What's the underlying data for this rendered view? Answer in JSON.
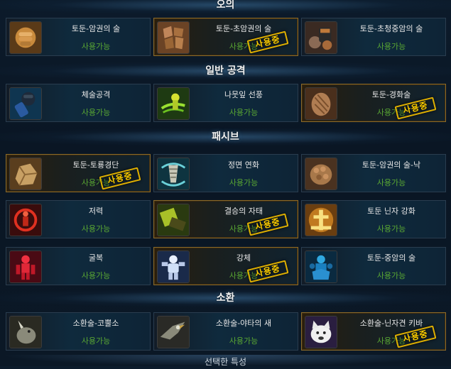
{
  "sections": [
    {
      "title": "오의"
    },
    {
      "title": "일반 공격"
    },
    {
      "title": "패시브"
    },
    {
      "title": "소환"
    }
  ],
  "skills": [
    {
      "name": "토둔-암권의 술",
      "status": "사용가능",
      "icon": "fist-icon",
      "active": false
    },
    {
      "name": "토둔-초암권의 술",
      "status": "사용가능",
      "icon": "rock-body-icon",
      "active": true
    },
    {
      "name": "토둔-초청중암의 술",
      "status": "사용가능",
      "icon": "heavy-punch-icon",
      "active": false
    },
    {
      "name": "체술공격",
      "status": "사용가능",
      "icon": "gauntlet-icon",
      "active": false
    },
    {
      "name": "나뭇잎 선풍",
      "status": "사용가능",
      "icon": "leaf-whirlwind-icon",
      "active": false
    },
    {
      "name": "토둔-경화술",
      "status": "사용가능",
      "icon": "hardening-icon",
      "active": true
    },
    {
      "name": "토둔-토룡경단",
      "status": "사용가능",
      "icon": "boulder-icon",
      "active": true
    },
    {
      "name": "정면 연화",
      "status": "사용가능",
      "icon": "drill-icon",
      "active": false
    },
    {
      "name": "토둔-암권의 술-낙",
      "status": "사용가능",
      "icon": "rock-fist-icon",
      "active": false
    },
    {
      "name": "저력",
      "status": "사용가능",
      "icon": "power-icon",
      "active": false
    },
    {
      "name": "결승의 자태",
      "status": "사용가능",
      "icon": "stance-icon",
      "active": true
    },
    {
      "name": "토둔 닌자 강화",
      "status": "사용가능",
      "icon": "earth-kanji-icon",
      "active": false
    },
    {
      "name": "굴복",
      "status": "사용가능",
      "icon": "submission-icon",
      "active": false
    },
    {
      "name": "강체",
      "status": "사용가능",
      "icon": "strong-body-icon",
      "active": true
    },
    {
      "name": "토둔-중암의 술",
      "status": "사용가능",
      "icon": "heavy-rock-icon",
      "active": false
    },
    {
      "name": "소환술-코뿔소",
      "status": "사용가능",
      "icon": "rhino-icon",
      "active": false
    },
    {
      "name": "소환술-야타의 새",
      "status": "사용가능",
      "icon": "bird-icon",
      "active": false
    },
    {
      "name": "소환술-닌자견 키바",
      "status": "사용가능",
      "icon": "ninja-dog-icon",
      "active": true
    }
  ],
  "stamp_label": "사용중",
  "bottom_title": "선택한 특성"
}
